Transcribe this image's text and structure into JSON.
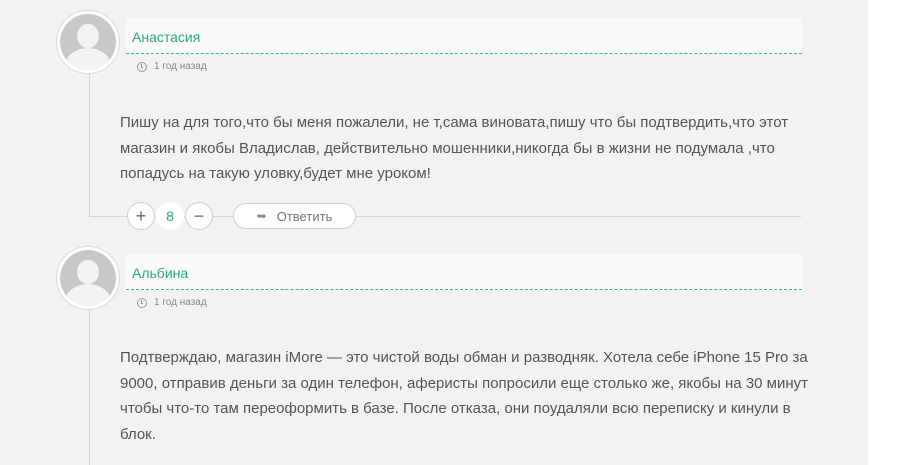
{
  "comments": [
    {
      "author": "Анастасия",
      "time": "1 год назад",
      "text": "Пишу на для того,что бы меня пожалели, не т,сама виновата,пишу что бы подтвердить,что этот магазин и якобы Владислав, действительно мошенники,никогда бы в жизни не подумала ,что попадусь на такую уловку,будет мне уроком!",
      "votes": "8",
      "upvote": "+",
      "downvote": "−",
      "reply_label": "Ответить",
      "reply_icon": "➥"
    },
    {
      "author": "Альбина",
      "time": "1 год назад",
      "text": "Подтверждаю, магазин iMore — это чистой воды обман и разводняк. Хотела себе iPhone 15 Pro за 9000, отправив деньги за один телефон, аферисты попросили еще столько же, якобы на 30 минут чтобы что-то там переоформить в базе. После отказа, они поудаляли всю переписку и кинули в блок."
    }
  ],
  "colors": {
    "accent": "#2aa980",
    "background": "#f2f2f2",
    "text": "#555555"
  },
  "icons": {
    "avatar": "default-user-avatar",
    "time": "clock-icon",
    "reply": "reply-arrow-icon"
  }
}
